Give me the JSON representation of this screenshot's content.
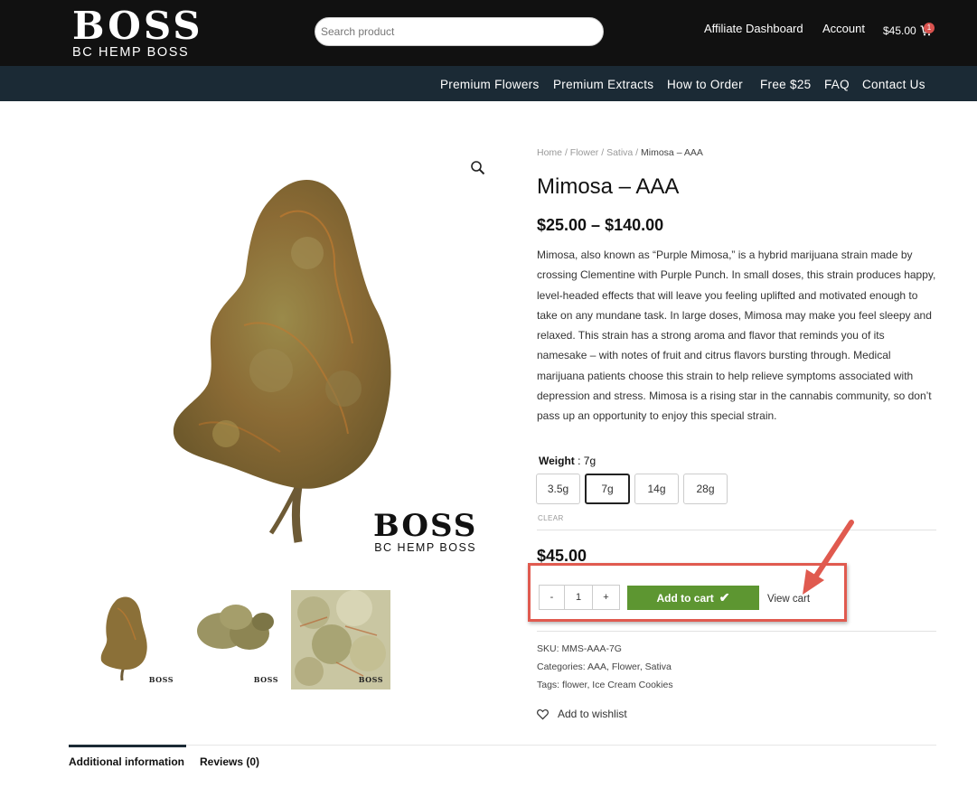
{
  "header": {
    "logo_main": "BOSS",
    "logo_sub": "BC HEMP BOSS",
    "search_placeholder": "Search product",
    "affiliate_link": "Affiliate Dashboard",
    "account_link": "Account",
    "cart_total": "$45.00",
    "cart_count": "1",
    "cart_icon": "cart-icon"
  },
  "nav": {
    "items": [
      "Premium Flowers",
      "Premium Extracts",
      "How to Order",
      "Free $25",
      "FAQ",
      "Contact Us"
    ]
  },
  "gallery": {
    "zoom_icon": "magnifier-icon",
    "watermark_main": "BOSS",
    "watermark_sub": "BC HEMP BOSS",
    "thumb_watermark": "BOSS"
  },
  "breadcrumb": {
    "items": [
      "Home",
      "Flower",
      "Sativa"
    ],
    "separator": "/",
    "current": "Mimosa – AAA"
  },
  "product": {
    "title": "Mimosa – AAA",
    "price_range": "$25.00 – $140.00",
    "description": "Mimosa, also known as “Purple Mimosa,” is a hybrid marijuana strain made by crossing Clementine with Purple Punch. In small doses, this strain produces happy, level-headed effects that will leave you feeling uplifted and motivated enough to take on any mundane task. In large doses, Mimosa may make you feel sleepy and relaxed. This strain has a strong aroma and flavor that reminds you of its namesake – with notes of fruit and citrus flavors bursting through. Medical marijuana patients choose this strain to help relieve symptoms associated with depression and stress. Mimosa is a rising star in the cannabis community, so don’t pass up an opportunity to enjoy this special strain.",
    "weight_label": "Weight",
    "weight_selected": "7g",
    "weight_options": [
      "3.5g",
      "7g",
      "14g",
      "28g"
    ],
    "clear_label": "CLEAR",
    "variation_price": "$45.00",
    "qty_minus": "-",
    "qty_value": "1",
    "qty_plus": "+",
    "add_to_cart": "Add to cart",
    "add_to_cart_check": "✔",
    "view_cart": "View cart",
    "sku_label": "SKU:",
    "sku": "MMS-AAA-7G",
    "categories_label": "Categories:",
    "categories": "AAA, Flower, Sativa",
    "tags_label": "Tags:",
    "tags": "flower, Ice Cream Cookies",
    "wishlist": "Add to wishlist"
  },
  "tabs": [
    "Additional information",
    "Reviews (0)"
  ],
  "colors": {
    "header_bg": "#111111",
    "nav_bg": "#1b2a35",
    "cart_button": "#5d9631",
    "highlight": "#e05a4f",
    "badge": "#d9534f"
  }
}
